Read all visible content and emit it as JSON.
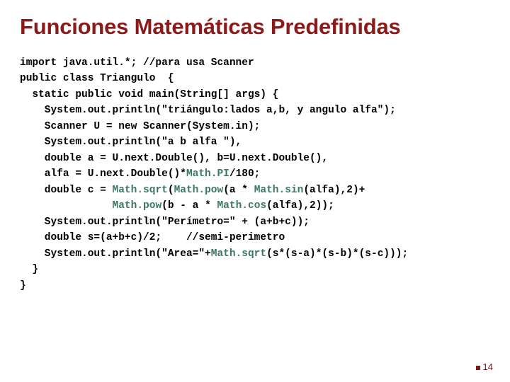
{
  "title": "Funciones Matemáticas Predefinidas",
  "code": {
    "l01": "import java.util.*; //para usa Scanner",
    "l02": "public class Triangulo  {",
    "l03": "  static public void main(String[] args) {",
    "l04": "    System.out.println(\"triángulo:lados a,b, y angulo alfa\");",
    "l05": "    Scanner U = new Scanner(System.in);",
    "l06": "    System.out.println(\"a b alfa \"),",
    "l07a": "    double a = U.next.Double(), b=U.next.Double(),",
    "l08a": "    alfa = U.next.Double()*",
    "l08b": "Math.PI",
    "l08c": "/180;",
    "l09a": "    double c = ",
    "l09b": "Math.sqrt",
    "l09c": "(",
    "l09d": "Math.pow",
    "l09e": "(a * ",
    "l09f": "Math.sin",
    "l09g": "(alfa),2)+",
    "l10a": "               ",
    "l10b": "Math.pow",
    "l10c": "(b - a * ",
    "l10d": "Math.cos",
    "l10e": "(alfa),2));",
    "l11": "    System.out.println(\"Perímetro=\" + (a+b+c));",
    "l12": "    double s=(a+b+c)/2;    //semi-perimetro",
    "l13a": "    System.out.println(\"Area=\"+",
    "l13b": "Math.sqrt",
    "l13c": "(s*(s-a)*(s-b)*(s-c)));",
    "l14": "  }",
    "l15": "}"
  },
  "page_number": "14"
}
